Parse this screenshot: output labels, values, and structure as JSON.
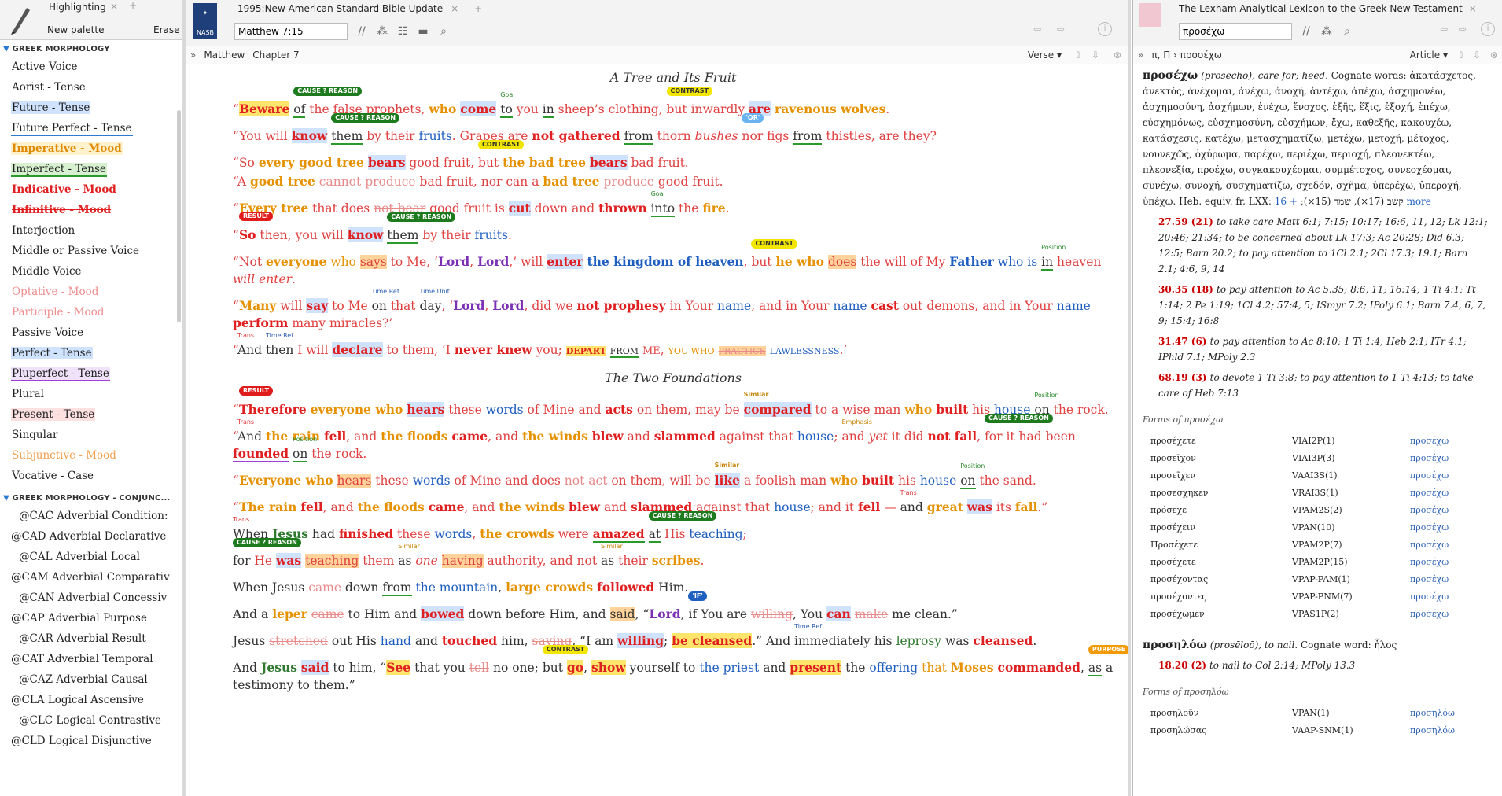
{
  "left": {
    "tab_title": "Highlighting",
    "new_palette": "New palette",
    "erase": "Erase",
    "section1": "GREEK MORPHOLOGY",
    "items1": [
      {
        "label": "Active Voice",
        "style": "plain"
      },
      {
        "label": "Aorist - Tense",
        "style": "plain"
      },
      {
        "label": "Future - Tense",
        "style": "blue-bg"
      },
      {
        "label": "Future Perfect - Tense",
        "style": "blue-ul"
      },
      {
        "label": "Imperative - Mood",
        "style": "orange-bold"
      },
      {
        "label": "Imperfect - Tense",
        "style": "green-bg"
      },
      {
        "label": "Indicative - Mood",
        "style": "red-bold"
      },
      {
        "label": "Infinitive - Mood",
        "style": "red-strike"
      },
      {
        "label": "Interjection",
        "style": "plain"
      },
      {
        "label": "Middle or Passive Voice",
        "style": "plain"
      },
      {
        "label": "Middle Voice",
        "style": "plain"
      },
      {
        "label": "Optative - Mood",
        "style": "pink"
      },
      {
        "label": "Participle - Mood",
        "style": "pink"
      },
      {
        "label": "Passive Voice",
        "style": "plain"
      },
      {
        "label": "Perfect - Tense",
        "style": "blue-bg"
      },
      {
        "label": "Pluperfect - Tense",
        "style": "purple-ul"
      },
      {
        "label": "Plural",
        "style": "plain"
      },
      {
        "label": "Present - Tense",
        "style": "pink-bg"
      },
      {
        "label": "Singular",
        "style": "plain"
      },
      {
        "label": "Subjunctive - Mood",
        "style": "orange"
      },
      {
        "label": "Vocative - Case",
        "style": "plain"
      }
    ],
    "section2": "GREEK MORPHOLOGY - CONJUNC...",
    "items2": [
      "@CAC Adverbial Condition:",
      "@CAD Adverbial Declarative",
      "@CAL Adverbial Local",
      "@CAM Adverbial Comparativ",
      "@CAN Adverbial Concessiv",
      "@CAP Adverbial Purpose",
      "@CAR Adverbial Result",
      "@CAT Adverbial Temporal",
      "@CAZ Adverbial Causal",
      "@CLA Logical Ascensive",
      "@CLC Logical Contrastive",
      "@CLD Logical Disjunctive"
    ]
  },
  "mid": {
    "tab_title": "1995:New American Standard Bible Update",
    "logo": "NASB",
    "reference": "Matthew 7:15",
    "book": "Matthew",
    "chapter": "Chapter 7",
    "view": "Verse",
    "heading1": "A Tree and Its Fruit",
    "heading2": "The Two Foundations",
    "tags": {
      "cause": "CAUSE ? REASON",
      "contrast": "CONTRAST",
      "result": "RESULT",
      "purpose": "PURPOSE",
      "or": "'OR'",
      "if": "'IF'",
      "goal": "Goal",
      "position": "Position",
      "time_ref": "Time Ref",
      "time_unit": "Time Unit",
      "trans": "Trans",
      "similar": "Similar",
      "emphasis": "Emphasis"
    }
  },
  "right": {
    "tab_title": "The Lexham Analytical Lexicon to the Greek New Testament",
    "search": "προσέχω",
    "nav_path": "π, Π › προσέχω",
    "view": "Article",
    "entry1": {
      "headword": "προσέχω",
      "translit": "(prosechō),",
      "gloss": "care for; heed.",
      "cognates_label": "Cognate words:",
      "cognates": "ἀκατάσχετος, ἀνεκτός, ἀνέχομαι, ἀνέχω, ἀνοχή, ἀντέχω, ἀπέχω, ἀσχημονέω, ἀσχημοσύνη, ἀσχήμων, ἐνέχω, ἔνοχος, ἑξῆς, ἕξις, ἐξοχή, ἐπέχω, εὐσχημόνως, εὐσχημοσύνη, εὐσχήμων, ἔχω, καθεξῆς, κακουχέω, κατάσχεσις, κατέχω, μετασχηματίζω, μετέχω, μετοχή, μέτοχος, νουνεχῶς, ὀχύρωμα, παρέχω, περιέχω, περιοχή, πλεονεκτέω, πλεονεξία, προέχω, συγκακουχέομαι, συμμέτοχος, συνεοχέομαι, συνέχω, συνοχή, συσχηματίζω, σχεδόν, σχῆμα, ὑπερέχω, ὑπεροχή, ὑπέχω.",
      "heb": "Heb. equiv. fr. LXX: קשב (17×), שמר (15×);",
      "more": "+ 16 more",
      "defs": [
        {
          "num": "27.59",
          "count": "(21)",
          "text": "to take care Matt 6:1; 7:15; 10:17; 16:6, 11, 12; Lk 12:1; 20:46; 21:34; to be concerned about Lk 17:3; Ac 20:28; Did 6.3; 12:5; Barn 20.2; to pay attention to 1Cl 2.1; 2Cl 17.3; 19.1; Barn 2.1; 4:6, 9, 14"
        },
        {
          "num": "30.35",
          "count": "(18)",
          "text": "to pay attention to Ac 5:35; 8:6, 11; 16:14; 1 Ti 4:1; Tt 1:14; 2 Pe 1:19; 1Cl 4.2; 57:4, 5; ISmyr 7.2; IPoly 6.1; Barn 7.4, 6, 7, 9; 15:4; 16:8"
        },
        {
          "num": "31.47",
          "count": "(6)",
          "text": "to pay attention to Ac 8:10; 1 Ti 1:4; Heb 2:1; ITr 4.1; IPhld 7.1; MPoly 2.3"
        },
        {
          "num": "68.19",
          "count": "(3)",
          "text": "to devote 1 Ti 3:8; to pay attention to 1 Ti 4:13; to take care of Heb 7:13"
        }
      ],
      "forms_label": "Forms of προσέχω",
      "forms": [
        [
          "προσέχετε",
          "VIAI2P(1)",
          "προσέχω"
        ],
        [
          "προσεῖχον",
          "VIAI3P(3)",
          "προσέχω"
        ],
        [
          "προσεῖχεν",
          "VAAI3S(1)",
          "προσέχω"
        ],
        [
          "προσεσχηκεν",
          "VRAI3S(1)",
          "προσέχω"
        ],
        [
          "πρόσεχε",
          "VPAM2S(2)",
          "προσέχω"
        ],
        [
          "προσέχειν",
          "VPAN(10)",
          "προσέχω"
        ],
        [
          "Προσέχετε",
          "VPAM2P(7)",
          "προσέχω"
        ],
        [
          "προσέχετε",
          "VPAM2P(15)",
          "προσέχω"
        ],
        [
          "προσέχοντας",
          "VPAP-PAM(1)",
          "προσέχω"
        ],
        [
          "προσέχοντες",
          "VPAP-PNM(7)",
          "προσέχω"
        ],
        [
          "προσέχωμεν",
          "VPAS1P(2)",
          "προσέχω"
        ]
      ]
    },
    "entry2": {
      "headword": "προσηλόω",
      "translit": "(prosēloō),",
      "gloss": "to nail.",
      "cognates_label": "Cognate word:",
      "cognates": "ἧλος",
      "def": {
        "num": "18.20",
        "count": "(2)",
        "text": "to nail to Col 2:14; MPoly 13.3"
      },
      "forms_label": "Forms of προσηλόω",
      "forms": [
        [
          "προσηλοῦν",
          "VPAN(1)",
          "προσηλόω"
        ],
        [
          "προσηλώσας",
          "VAAP-SNM(1)",
          "προσηλόω"
        ]
      ]
    }
  }
}
